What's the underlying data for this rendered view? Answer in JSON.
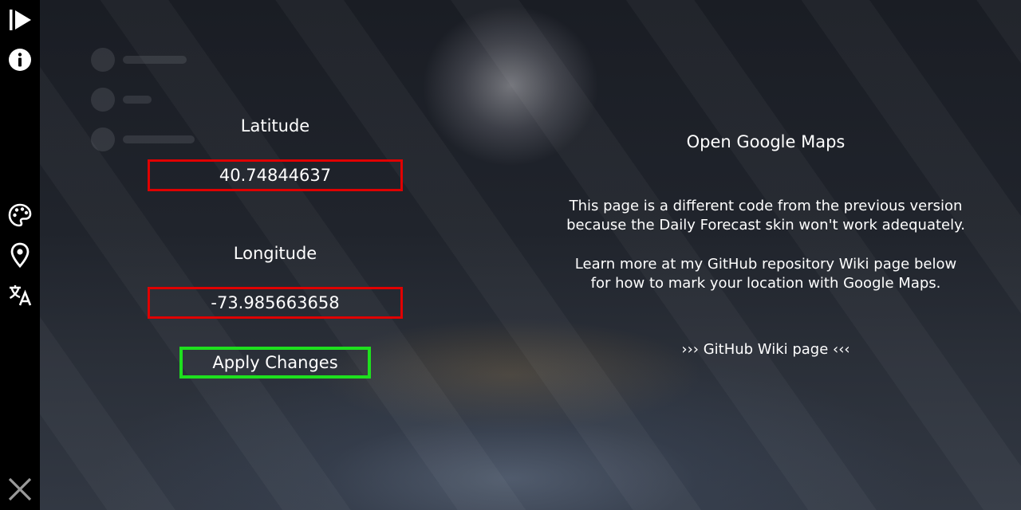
{
  "left": {
    "latitude_label": "Latitude",
    "latitude_value": "40.74844637",
    "longitude_label": "Longitude",
    "longitude_value": "-73.985663658",
    "apply_label": "Apply Changes"
  },
  "right": {
    "maps_title": "Open Google Maps",
    "para1_line1": "This page is a different code from the previous version",
    "para1_line2": "because the Daily Forecast skin won't work adequately.",
    "para2_line1": "Learn more at my GitHub repository Wiki page below",
    "para2_line2": "for how to mark your location with Google Maps.",
    "wiki_link": "››› GitHub Wiki page ‹‹‹"
  },
  "sidebar": {
    "icons": [
      "play-icon",
      "info-icon",
      "palette-icon",
      "location-pin-icon",
      "translate-icon",
      "close-icon"
    ]
  },
  "colors": {
    "sidebar_bg": "#000000",
    "field_border": "#e00000",
    "apply_border": "#1ee01e",
    "text": "#ffffff"
  }
}
